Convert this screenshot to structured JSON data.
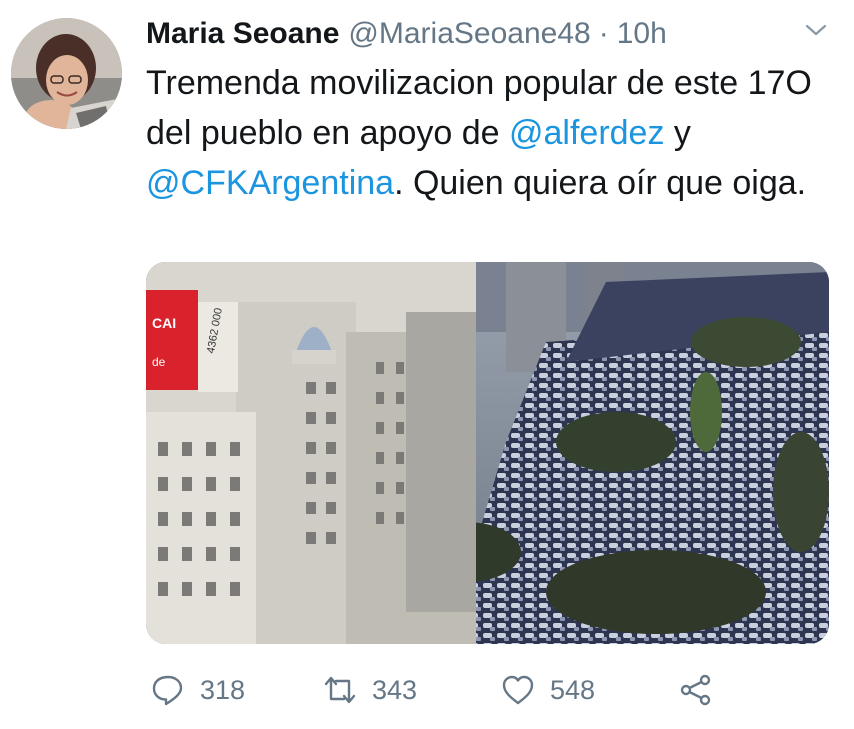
{
  "tweet": {
    "author_name": "Maria Seoane",
    "handle": "@MariaSeoane48",
    "separator": "·",
    "time": "10h",
    "text_part1": "Tremenda movilizacion popular de este 17O del pueblo en apoyo de ",
    "mention1": "@alferdez",
    "text_part2": " y ",
    "mention2": "@CFKArgentina",
    "text_part3": ". Quien quiera oír que oiga."
  },
  "actions": {
    "reply_count": "318",
    "retweet_count": "343",
    "like_count": "548"
  },
  "media": {
    "sign_text_1": "CAI",
    "sign_text_2": "de",
    "sign_text_3": "4362 000"
  },
  "icons": {
    "caret": "chevron-down-icon",
    "reply": "reply-icon",
    "retweet": "retweet-icon",
    "like": "heart-icon",
    "share": "share-icon"
  },
  "colors": {
    "link": "#1b95e0",
    "secondary_text": "#657786",
    "primary_text": "#14171a"
  }
}
